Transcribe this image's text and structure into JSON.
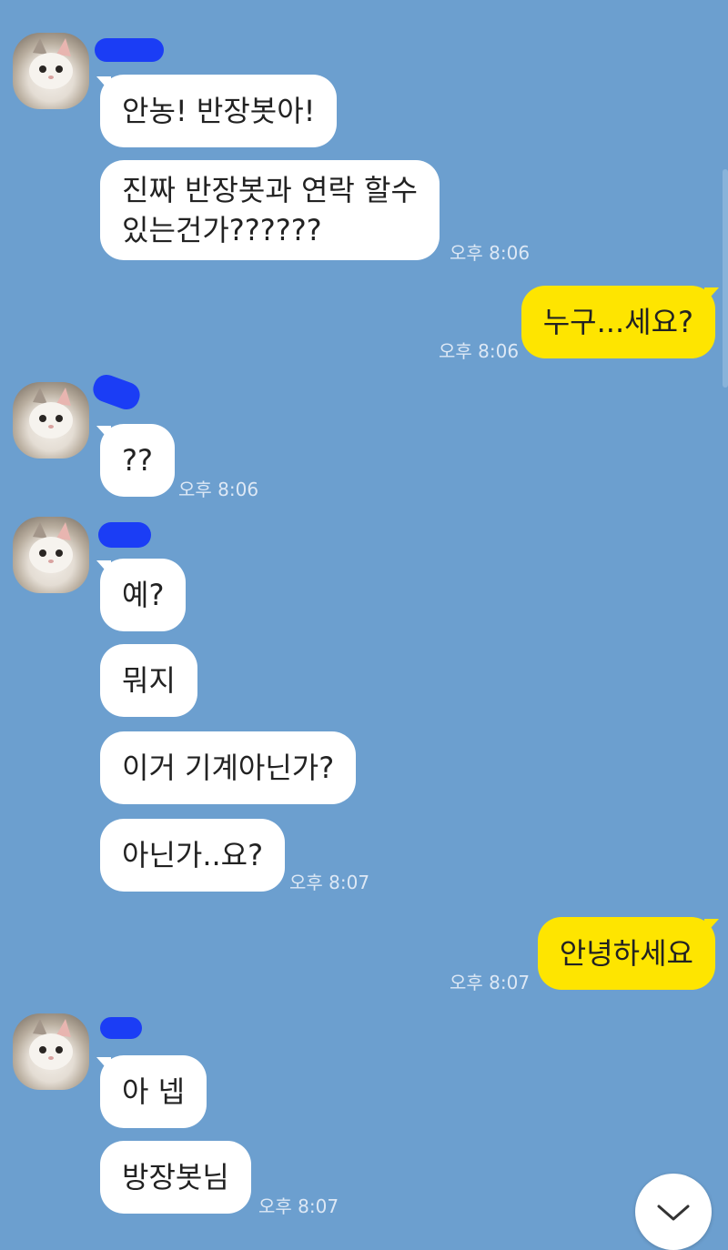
{
  "colors": {
    "background": "#6c9fcf",
    "incoming_bubble": "#ffffff",
    "outgoing_bubble": "#fee500",
    "redaction": "#1b3df5"
  },
  "messages": {
    "g1": {
      "m1": "안농! 반장봇아!",
      "m2": "진짜 반장봇과 연락 할수\n있는건가??????",
      "time": "오후 8:06"
    },
    "o1": {
      "m1": "누구...세요?",
      "time": "오후 8:06"
    },
    "g2": {
      "m1": "??",
      "time": "오후 8:06"
    },
    "g3": {
      "m1": "예?",
      "m2": "뭐지",
      "m3": "이거 기계아닌가?",
      "m4": "아닌가..요?",
      "time": "오후 8:07"
    },
    "o2": {
      "m1": "안녕하세요",
      "time": "오후 8:07"
    },
    "g4": {
      "m1": "아 넵",
      "m2": "방장봇님",
      "time": "오후 8:07"
    }
  },
  "icons": {
    "avatar": "cat-photo",
    "scroll_down": "chevron-down-icon"
  }
}
